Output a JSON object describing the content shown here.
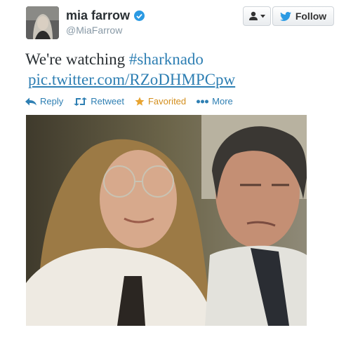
{
  "user": {
    "name": "mia farrow",
    "handle": "@MiaFarrow"
  },
  "buttons": {
    "follow_label": "Follow"
  },
  "tweet": {
    "text_before": "We're watching ",
    "hashtag": "#sharknado",
    "link": "pic.twitter.com/RZoDHMPCpw"
  },
  "actions": {
    "reply": "Reply",
    "retweet": "Retweet",
    "favorited": "Favorited",
    "more": "More"
  },
  "colors": {
    "link": "#2e7fb3",
    "favorited": "#d38e1d",
    "verified": "#2b9ae3"
  },
  "icons": [
    "verified-badge-icon",
    "user-actions-icon",
    "caret-down-icon",
    "twitter-bird-icon",
    "reply-icon",
    "retweet-icon",
    "star-icon",
    "more-dots-icon"
  ]
}
